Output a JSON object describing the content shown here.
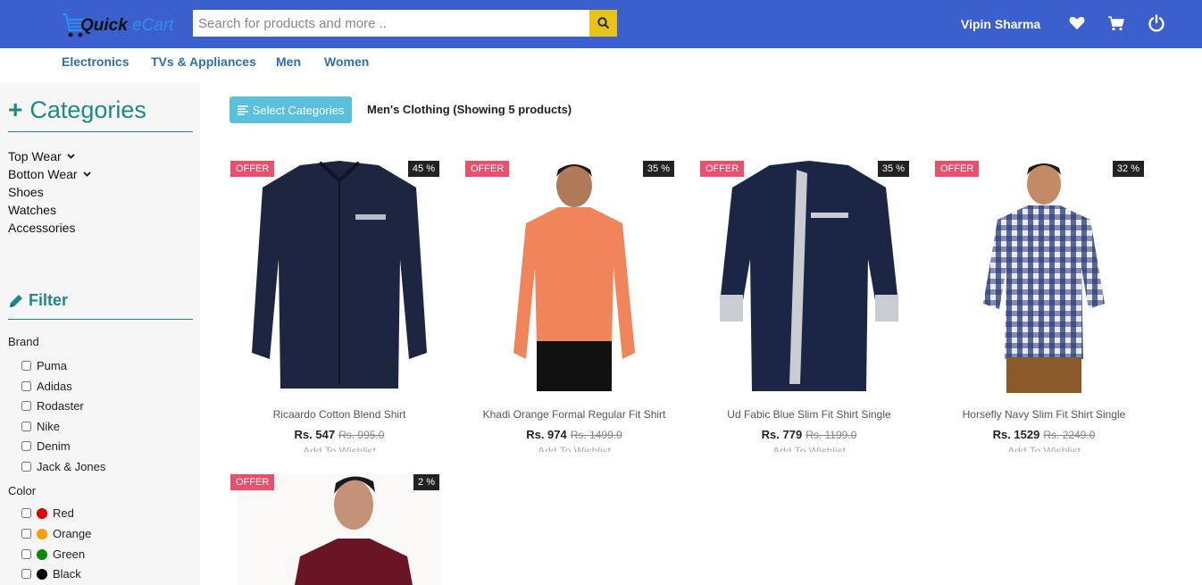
{
  "header": {
    "logo_main": "Quick",
    "logo_alt": " eCart",
    "search_placeholder": "Search for products and more ..",
    "user_name": "Vipin Sharma",
    "icons": [
      "heart-icon",
      "cart-icon",
      "power-icon"
    ]
  },
  "nav": [
    "Electronics",
    "TVs & Appliances",
    "Men",
    "Women"
  ],
  "sidebar": {
    "categories_title": "Categories",
    "categories": [
      {
        "label": "Top Wear",
        "expandable": true
      },
      {
        "label": "Botton Wear",
        "expandable": true
      },
      {
        "label": "Shoes",
        "expandable": false
      },
      {
        "label": "Watches",
        "expandable": false
      },
      {
        "label": "Accessories",
        "expandable": false
      }
    ],
    "filter_title": "Filter",
    "brand_label": "Brand",
    "brands": [
      "Puma",
      "Adidas",
      "Rodaster",
      "Nike",
      "Denim",
      "Jack & Jones"
    ],
    "color_label": "Color",
    "colors": [
      {
        "label": "Red",
        "hex": "#e00000"
      },
      {
        "label": "Orange",
        "hex": "#f5a200"
      },
      {
        "label": "Green",
        "hex": "#0a8a0a"
      },
      {
        "label": "Black",
        "hex": "#000000"
      }
    ]
  },
  "main": {
    "select_categories_label": "Select Categories",
    "showing_text": "Men's Clothing (Showing 5 products)",
    "products": [
      {
        "name": "Ricaardo Cotton Blend Shirt",
        "price": "Rs. 547",
        "mrp": "Rs. 995.0",
        "discount": "45 %",
        "offer": "OFFER",
        "wishlist": "Add To Wishlist",
        "shirt_color": "#1d2540"
      },
      {
        "name": "Khadi Orange Formal Regular Fit Shirt",
        "price": "Rs. 974",
        "mrp": "Rs. 1499.0",
        "discount": "35 %",
        "offer": "OFFER",
        "wishlist": "Add To Wishlist",
        "shirt_color": "#f0845a"
      },
      {
        "name": "Ud Fabic Blue Slim Fit Shirt Single",
        "price": "Rs. 779",
        "mrp": "Rs. 1199.0",
        "discount": "35 %",
        "offer": "OFFER",
        "wishlist": "Add To Wishlist",
        "shirt_color": "#1b2645"
      },
      {
        "name": "Horsefly Navy Slim Fit Shirt Single",
        "price": "Rs. 1529",
        "mrp": "Rs. 2249.0",
        "discount": "32 %",
        "offer": "OFFER",
        "wishlist": "Add To Wishlist",
        "shirt_color": "#2b3a78"
      },
      {
        "name": "",
        "price": "",
        "mrp": "",
        "discount": "2 %",
        "offer": "OFFER",
        "wishlist": "",
        "shirt_color": "#6a1526"
      }
    ]
  }
}
